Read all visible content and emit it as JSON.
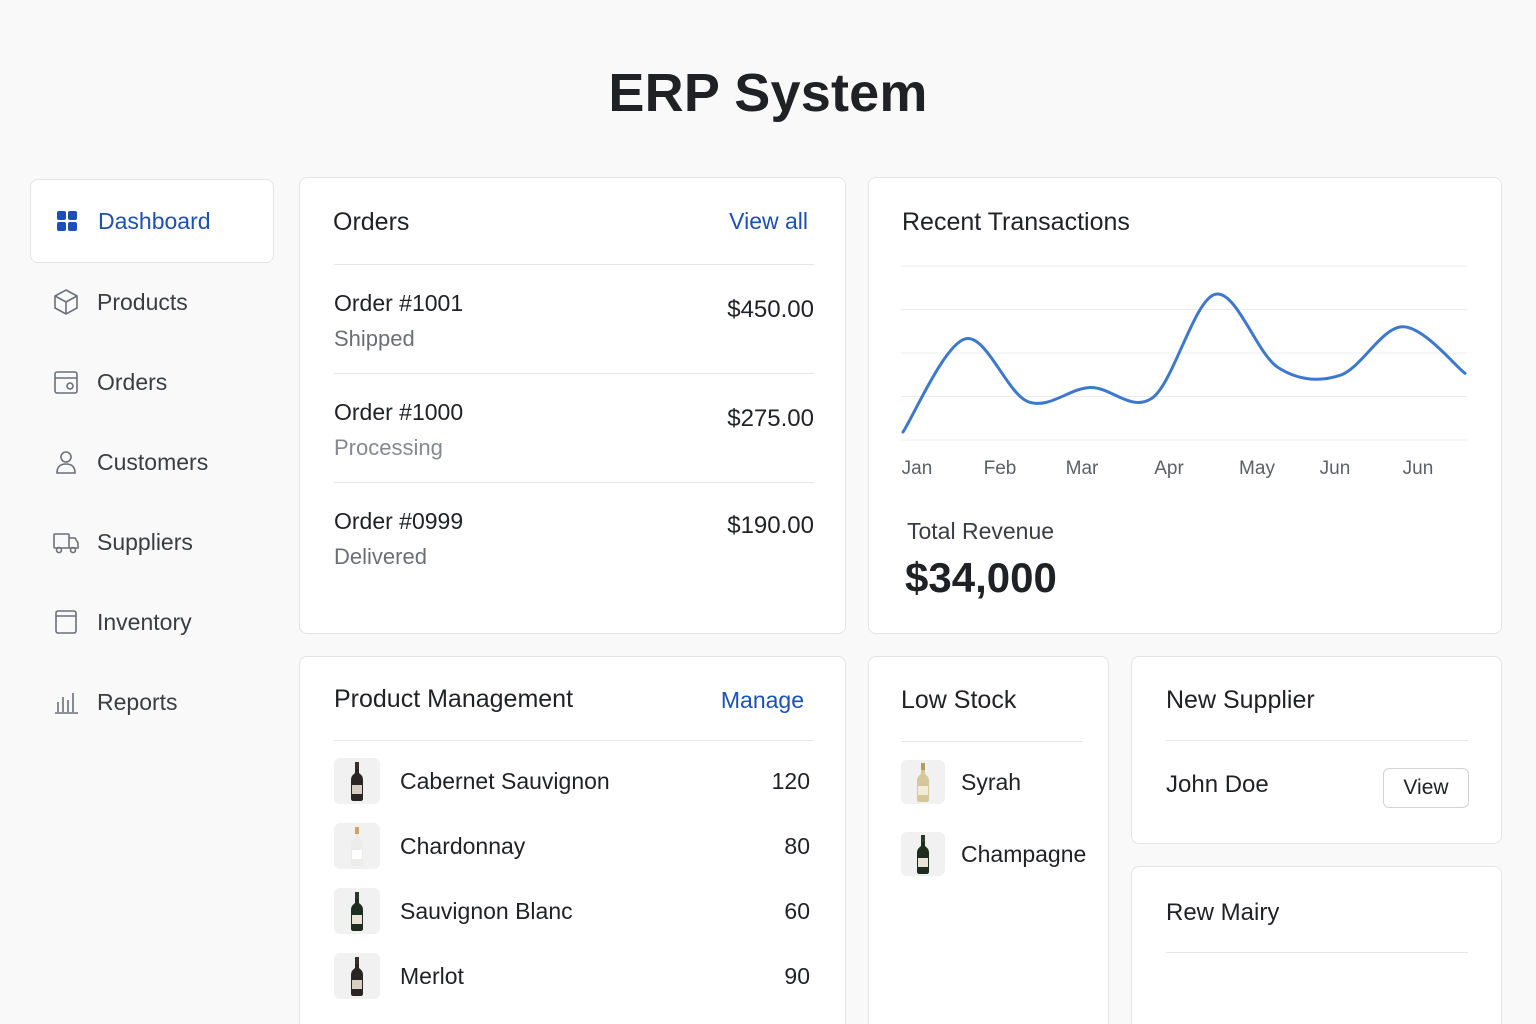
{
  "app": {
    "title": "ERP System"
  },
  "sidebar": {
    "items": [
      {
        "label": "Dashboard",
        "icon": "grid-icon",
        "active": true
      },
      {
        "label": "Products",
        "icon": "box-icon"
      },
      {
        "label": "Orders",
        "icon": "orders-icon"
      },
      {
        "label": "Customers",
        "icon": "user-icon"
      },
      {
        "label": "Suppliers",
        "icon": "truck-icon"
      },
      {
        "label": "Inventory",
        "icon": "inventory-icon"
      },
      {
        "label": "Reports",
        "icon": "bar-chart-icon"
      }
    ]
  },
  "orders": {
    "title": "Orders",
    "link": "View all",
    "items": [
      {
        "id": "Order #1001",
        "status": "Shipped",
        "amount": "$450.00"
      },
      {
        "id": "Order #1000",
        "status": "Processing",
        "amount": "$275.00"
      },
      {
        "id": "Order #0999",
        "status": "Delivered",
        "amount": "$190.00"
      }
    ]
  },
  "transactions": {
    "title": "Recent Transactions",
    "revenue_label": "Total Revenue",
    "revenue_value": "$34,000"
  },
  "chart_data": {
    "type": "line",
    "categories": [
      "Jan",
      "Feb",
      "Mar",
      "Apr",
      "May",
      "Jun",
      "Jun"
    ],
    "series": [
      {
        "values": [
          0,
          4.6,
          1.5,
          2.2,
          1.7,
          6.8,
          3.2,
          2.8,
          5.2,
          2.9
        ]
      }
    ],
    "color": "#3d78cc",
    "grid": true,
    "xlabel": "",
    "ylabel": ""
  },
  "products": {
    "title": "Product Management",
    "link": "Manage",
    "items": [
      {
        "name": "Cabernet Sauvignon",
        "qty": "120",
        "bottle": "dark"
      },
      {
        "name": "Chardonnay",
        "qty": "80",
        "bottle": "white"
      },
      {
        "name": "Sauvignon Blanc",
        "qty": "60",
        "bottle": "green"
      },
      {
        "name": "Merlot",
        "qty": "90",
        "bottle": "dark"
      }
    ]
  },
  "low_stock": {
    "title": "Low Stock",
    "items": [
      {
        "name": "Syrah",
        "bottle": "gold"
      },
      {
        "name": "Champagne",
        "bottle": "green"
      }
    ]
  },
  "new_supplier": {
    "title": "New Supplier",
    "name": "John Doe",
    "button": "View"
  },
  "supplier_two": {
    "name": "Rew Mairy"
  }
}
